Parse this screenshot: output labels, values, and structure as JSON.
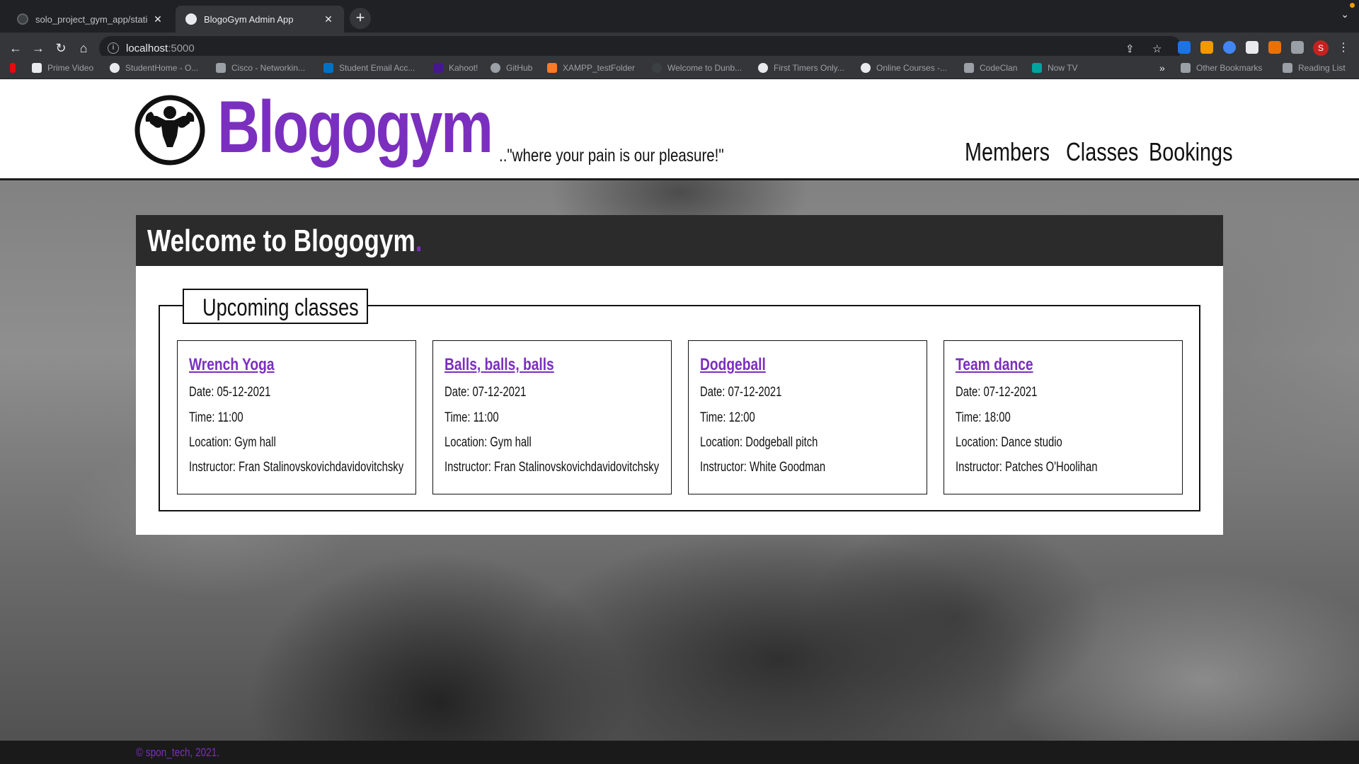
{
  "browser": {
    "tabs": [
      {
        "title": "solo_project_gym_app/static a",
        "active": false
      },
      {
        "title": "BlogoGym Admin App",
        "active": true
      }
    ],
    "new_tab": "+",
    "url_host": "localhost",
    "url_port": ":5000",
    "bookmarks": [
      "Prime Video",
      "StudentHome - O...",
      "Cisco - Networkin...",
      "Student Email Acc...",
      "Kahoot!",
      "GitHub",
      "XAMPP_testFolder",
      "Welcome to Dunb...",
      "First Timers Only...",
      "Online Courses -...",
      "CodeClan",
      "Now TV"
    ],
    "bookmarks_overflow": "»",
    "other_bookmarks": "Other Bookmarks",
    "reading_list": "Reading List",
    "profile_initial": "S"
  },
  "site": {
    "brand": "Blogogym",
    "tagline": "..\"where your pain is our pleasure!\"",
    "nav": [
      "Members",
      "Classes",
      "Bookings"
    ],
    "welcome": "Welcome to Blogogym",
    "welcome_dot": ".",
    "upcoming_title": "Upcoming classes",
    "classes": [
      {
        "name": "Wrench Yoga",
        "date": "Date: 05-12-2021",
        "time": "Time: 11:00",
        "location": "Location: Gym hall",
        "instructor": "Instructor: Fran Stalinovskovichdavidovitchsky"
      },
      {
        "name": "Balls, balls, balls",
        "date": "Date: 07-12-2021",
        "time": "Time: 11:00",
        "location": "Location: Gym hall",
        "instructor": "Instructor: Fran Stalinovskovichdavidovitchsky"
      },
      {
        "name": "Dodgeball",
        "date": "Date: 07-12-2021",
        "time": "Time: 12:00",
        "location": "Location: Dodgeball pitch",
        "instructor": "Instructor: White Goodman"
      },
      {
        "name": "Team dance",
        "date": "Date: 07-12-2021",
        "time": "Time: 18:00",
        "location": "Location: Dance studio",
        "instructor": "Instructor: Patches O'Hoolihan"
      }
    ],
    "footer": "© spon_tech, 2021."
  },
  "colors": {
    "brand_purple": "#7b2fbe",
    "header_bg": "#ffffff",
    "welcome_bar_bg": "#2b2b2b",
    "footer_bg": "#1a1a1a"
  }
}
